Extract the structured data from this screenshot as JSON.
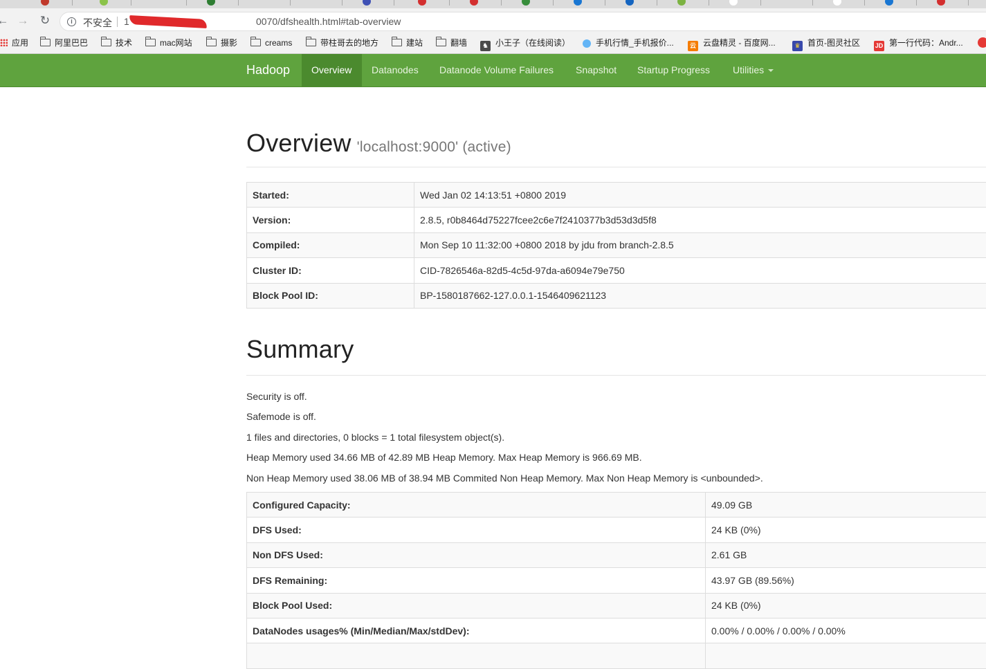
{
  "browser": {
    "insecure_label": "不安全",
    "url_start": "1",
    "url_rest": "0070/dfshealth.html#tab-overview",
    "bookmarks": [
      {
        "label": "应用",
        "icon": "apps-grid-icon"
      },
      {
        "label": "阿里巴巴",
        "icon": "folder-icon"
      },
      {
        "label": "技术",
        "icon": "folder-icon"
      },
      {
        "label": "mac网站",
        "icon": "folder-icon"
      },
      {
        "label": "摄影",
        "icon": "folder-icon"
      },
      {
        "label": "creams",
        "icon": "folder-icon"
      },
      {
        "label": "带柱哥去的地方",
        "icon": "folder-icon"
      },
      {
        "label": "建站",
        "icon": "folder-icon"
      },
      {
        "label": "翻墙",
        "icon": "folder-icon"
      },
      {
        "label": "小王子（在线阅读）",
        "icon": "bookmark-favicon-icon"
      },
      {
        "label": "手机行情_手机报价...",
        "icon": "bookmark-favicon-icon"
      },
      {
        "label": "云盘精灵 - 百度网...",
        "icon": "bookmark-favicon-icon"
      },
      {
        "label": "首页-图灵社区",
        "icon": "bookmark-favicon-icon"
      },
      {
        "label": "第一行代码：Andr...",
        "icon": "bookmark-favicon-icon"
      }
    ]
  },
  "navbar": {
    "brand": "Hadoop",
    "items": [
      {
        "label": "Overview",
        "active": true
      },
      {
        "label": "Datanodes"
      },
      {
        "label": "Datanode Volume Failures"
      },
      {
        "label": "Snapshot"
      },
      {
        "label": "Startup Progress"
      },
      {
        "label": "Utilities"
      }
    ]
  },
  "overview": {
    "title": "Overview",
    "subtitle": "'localhost:9000' (active)",
    "rows": [
      {
        "key": "Started:",
        "value": "Wed Jan 02 14:13:51 +0800 2019"
      },
      {
        "key": "Version:",
        "value": "2.8.5, r0b8464d75227fcee2c6e7f2410377b3d53d3d5f8"
      },
      {
        "key": "Compiled:",
        "value": "Mon Sep 10 11:32:00 +0800 2018 by jdu from branch-2.8.5"
      },
      {
        "key": "Cluster ID:",
        "value": "CID-7826546a-82d5-4c5d-97da-a6094e79e750"
      },
      {
        "key": "Block Pool ID:",
        "value": "BP-1580187662-127.0.0.1-1546409621123"
      }
    ]
  },
  "summary": {
    "title": "Summary",
    "lines": [
      "Security is off.",
      "Safemode is off.",
      "1 files and directories, 0 blocks = 1 total filesystem object(s).",
      "Heap Memory used 34.66 MB of 42.89 MB Heap Memory. Max Heap Memory is 966.69 MB.",
      "Non Heap Memory used 38.06 MB of 38.94 MB Commited Non Heap Memory. Max Non Heap Memory is <unbounded>."
    ],
    "rows": [
      {
        "key": "Configured Capacity:",
        "value": "49.09 GB"
      },
      {
        "key": "DFS Used:",
        "value": "24 KB (0%)"
      },
      {
        "key": "Non DFS Used:",
        "value": "2.61 GB"
      },
      {
        "key": "DFS Remaining:",
        "value": "43.97 GB (89.56%)"
      },
      {
        "key": "Block Pool Used:",
        "value": "24 KB (0%)"
      },
      {
        "key": "DataNodes usages% (Min/Median/Max/stdDev):",
        "value": "0.00% / 0.00% / 0.00% / 0.00%"
      },
      {
        "key": "",
        "value": ""
      }
    ]
  },
  "colors": {
    "navbar_green": "#5fa33e",
    "navbar_active": "#4b8a2e",
    "url_redaction": "#e0292b"
  }
}
